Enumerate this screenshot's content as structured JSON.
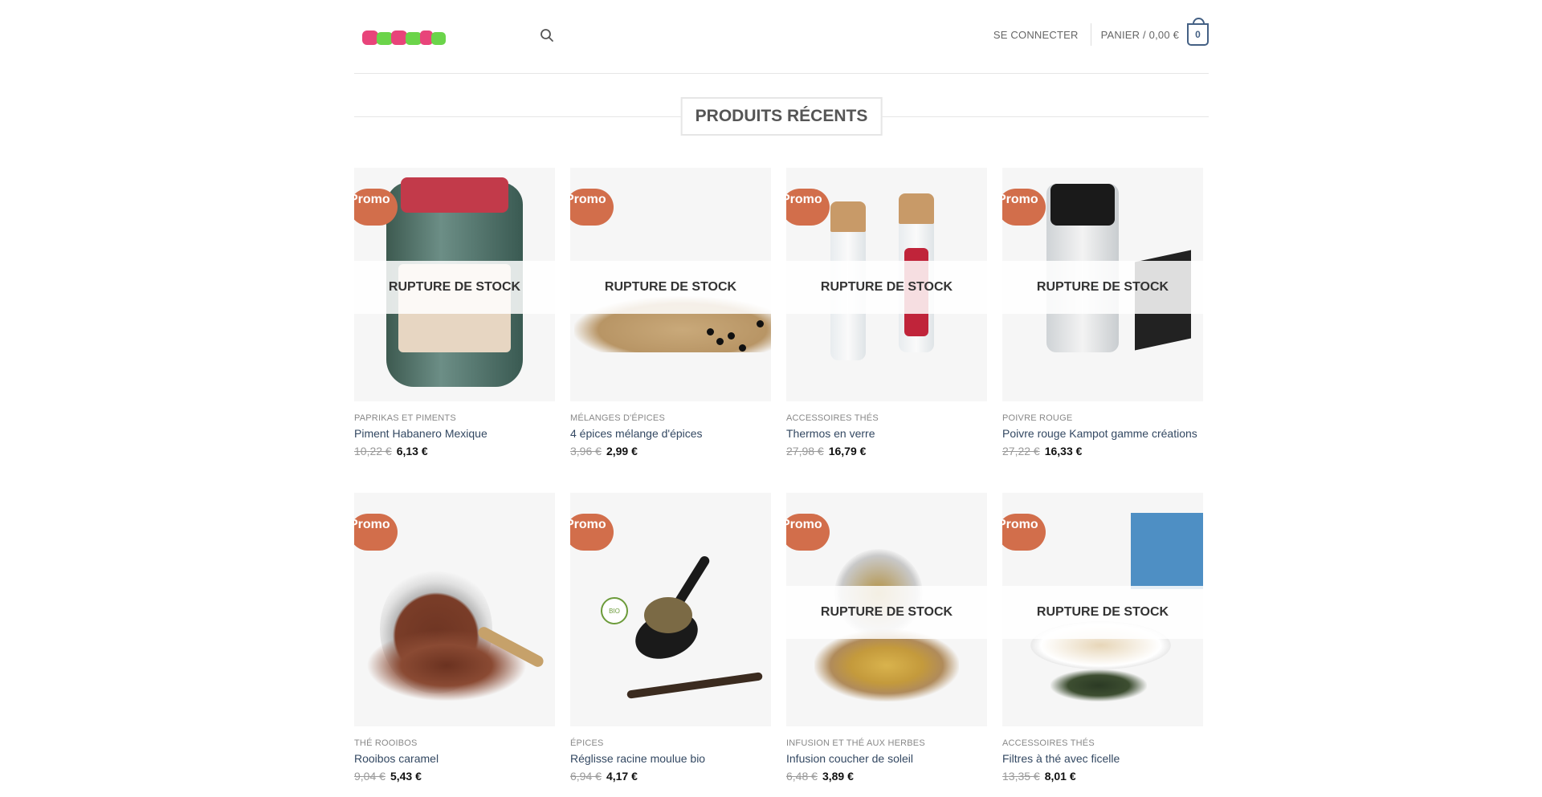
{
  "header": {
    "logo_alt": "logo",
    "login_label": "SE CONNECTER",
    "cart_label": "PANIER / 0,00 €",
    "cart_count": "0",
    "colors": {
      "accent": "#446084",
      "promo": "#d26e4b"
    }
  },
  "section": {
    "title": "PRODUITS RÉCENTS"
  },
  "labels": {
    "promo": "Promo !",
    "out_of_stock": "RUPTURE DE STOCK"
  },
  "products": [
    {
      "category": "PAPRIKAS ET PIMENTS",
      "name": "Piment Habanero Mexique",
      "old_price": "10,22 €",
      "price": "6,13 €",
      "out_of_stock": true
    },
    {
      "category": "MÉLANGES D'ÉPICES",
      "name": "4 épices mélange d'épices",
      "old_price": "3,96 €",
      "price": "2,99 €",
      "out_of_stock": true
    },
    {
      "category": "ACCESSOIRES THÉS",
      "name": "Thermos en verre",
      "old_price": "27,98 €",
      "price": "16,79 €",
      "out_of_stock": true
    },
    {
      "category": "POIVRE ROUGE",
      "name": "Poivre rouge Kampot gamme créations",
      "old_price": "27,22 €",
      "price": "16,33 €",
      "out_of_stock": true
    },
    {
      "category": "THÉ ROOIBOS",
      "name": "Rooibos caramel",
      "old_price": "9,04 €",
      "price": "5,43 €",
      "out_of_stock": false
    },
    {
      "category": "ÉPICES",
      "name": "Réglisse racine moulue bio",
      "old_price": "6,94 €",
      "price": "4,17 €",
      "out_of_stock": false,
      "badge": "BIO"
    },
    {
      "category": "INFUSION ET THÉ AUX HERBES",
      "name": "Infusion coucher de soleil",
      "old_price": "6,48 €",
      "price": "3,89 €",
      "out_of_stock": true
    },
    {
      "category": "ACCESSOIRES THÉS",
      "name": "Filtres à thé avec ficelle",
      "old_price": "13,35 €",
      "price": "8,01 €",
      "out_of_stock": true
    }
  ]
}
